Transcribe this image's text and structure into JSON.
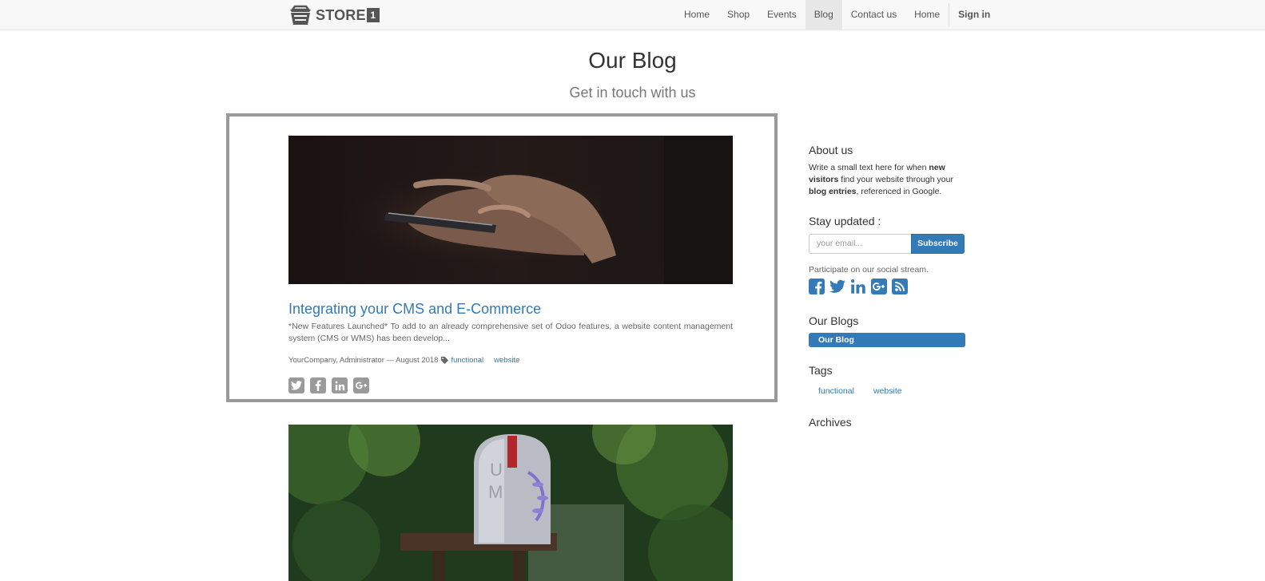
{
  "brand": {
    "name": "STORE",
    "badge": "1"
  },
  "nav": {
    "items": [
      {
        "label": "Home"
      },
      {
        "label": "Shop"
      },
      {
        "label": "Events"
      },
      {
        "label": "Blog"
      },
      {
        "label": "Contact us"
      },
      {
        "label": "Home"
      }
    ],
    "active": "Blog",
    "signin": "Sign in"
  },
  "header": {
    "title": "Our Blog",
    "subtitle": "Get in touch with us"
  },
  "posts": [
    {
      "title": "Integrating your CMS and E-Commerce",
      "teaser": "*New Features Launched* To add to an already comprehensive set of Odoo features, a website content management system (CMS or WMS) has been develop...",
      "meta": "YourCompany, Administrator — August 2018",
      "tags": [
        "functional",
        "website"
      ],
      "share": [
        "twitter-icon",
        "facebook-icon",
        "linkedin-icon",
        "google-plus-icon"
      ],
      "image": "hands-holding-phone"
    },
    {
      "image": "mailbox"
    }
  ],
  "sidebar": {
    "about": {
      "heading": "About us",
      "text_parts": [
        "Write a small text here for when ",
        "new visitors",
        " find your website through your ",
        "blog entries",
        ", referenced in Google."
      ]
    },
    "newsletter": {
      "heading": "Stay updated :",
      "placeholder": "your email...",
      "button": "Subscribe"
    },
    "social": {
      "text": "Participate on our social stream.",
      "icons": [
        "facebook-icon",
        "twitter-icon",
        "linkedin-icon",
        "google-plus-icon",
        "rss-icon"
      ],
      "color": "#337ab7"
    },
    "blogs": {
      "heading": "Our Blogs",
      "items": [
        "Our Blog"
      ]
    },
    "tags": {
      "heading": "Tags",
      "items": [
        "functional",
        "website"
      ]
    },
    "archives": {
      "heading": "Archives"
    }
  },
  "colors": {
    "accent": "#337ab7",
    "navbar_bg": "#f8f8f8",
    "frame": "#9a9a9a"
  }
}
